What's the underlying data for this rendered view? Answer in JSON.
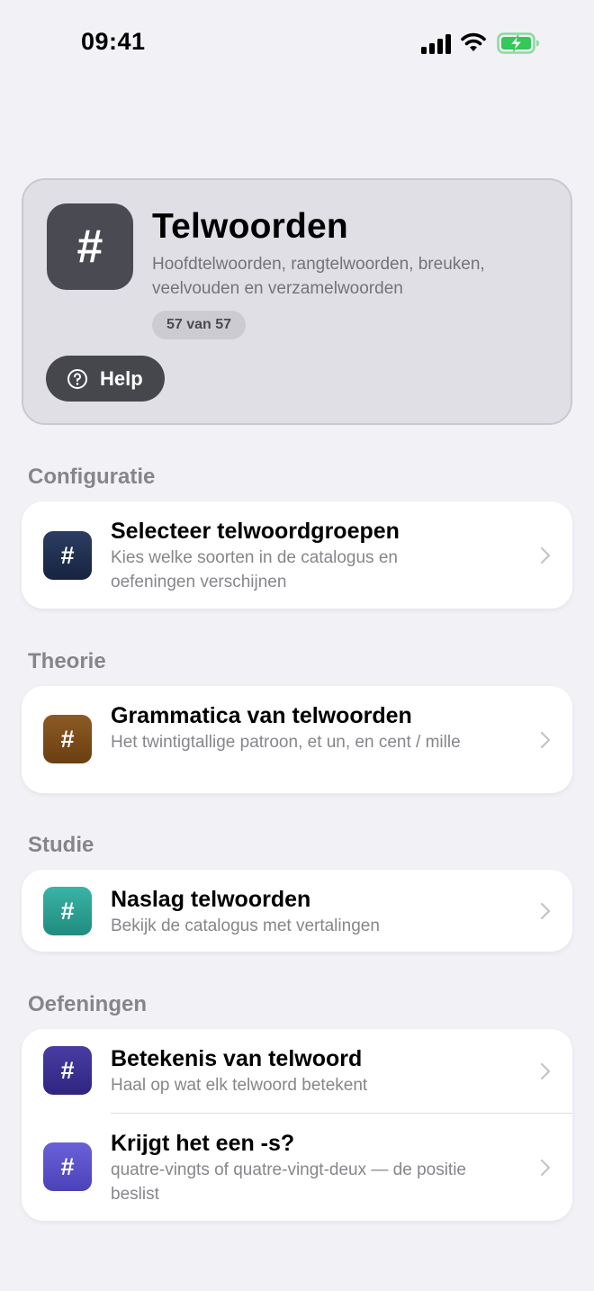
{
  "status_bar": {
    "time": "09:41"
  },
  "header": {
    "title": "Telwoorden",
    "subtitle": "Hoofdtelwoorden, rangtelwoorden, breuken, veelvouden en verzamelwoorden",
    "badge": "57 van 57",
    "help_label": "Help",
    "icon_glyph": "#"
  },
  "sections": {
    "configuratie": {
      "title": "Configuratie",
      "items": [
        {
          "title": "Selecteer telwoordgroepen",
          "subtitle": "Kies welke soorten in de catalogus en oefeningen verschijnen",
          "icon": "#",
          "color": "#1f2f4d"
        }
      ]
    },
    "theorie": {
      "title": "Theorie",
      "items": [
        {
          "title": "Grammatica van telwoorden",
          "subtitle": "Het twintigtallige patroon, et un, en cent / mille",
          "icon": "#",
          "color": "#7a4a18"
        }
      ]
    },
    "studie": {
      "title": "Studie",
      "items": [
        {
          "title": "Naslag telwoorden",
          "subtitle": "Bekijk de catalogus met vertalingen",
          "icon": "#",
          "color": "#2a9d8f"
        }
      ]
    },
    "oefeningen": {
      "title": "Oefeningen",
      "items": [
        {
          "title": "Betekenis van telwoord",
          "subtitle": "Haal op wat elk telwoord betekent",
          "icon": "#",
          "color": "#3b2f8f"
        },
        {
          "title": "Krijgt het een -s?",
          "subtitle": "quatre-vingts of quatre-vingt-deux — de positie beslist",
          "icon": "#",
          "color": "#5a4fc8"
        }
      ]
    }
  },
  "colors": {
    "background": "#f2f1f6",
    "hero_background": "#dfdfe5",
    "section_header": "#85858a",
    "subtitle_text": "#86868b",
    "battery_green": "#34c759"
  }
}
